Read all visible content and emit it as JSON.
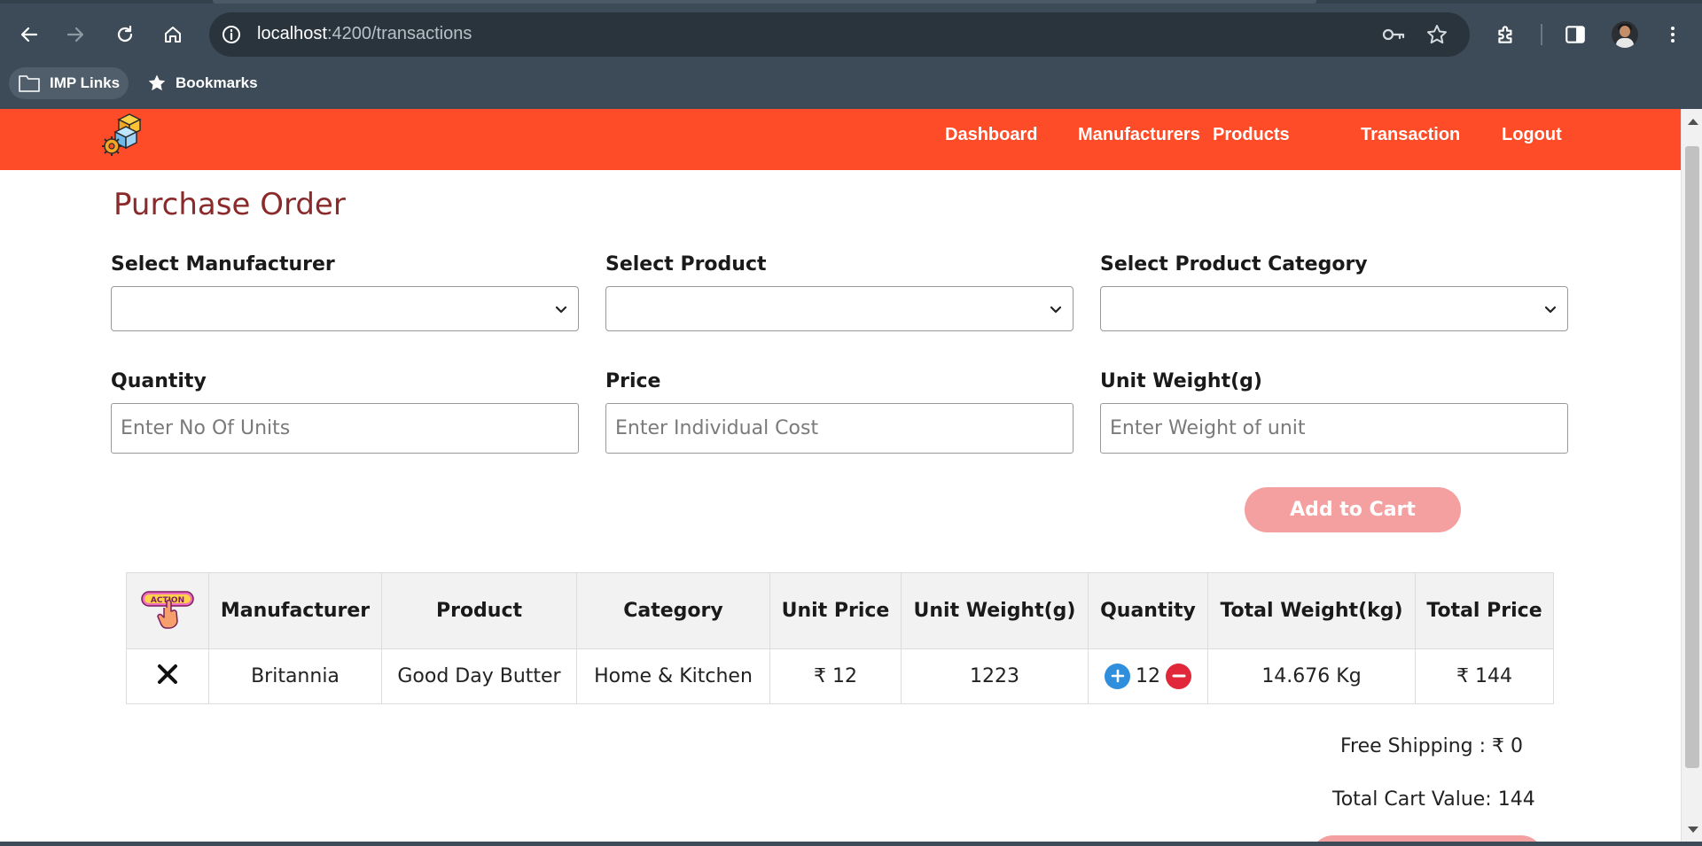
{
  "browser": {
    "url_host": "localhost",
    "url_path": ":4200/transactions",
    "bookmarks": [
      {
        "label": "IMP Links",
        "icon": "folder-icon"
      },
      {
        "label": "Bookmarks",
        "icon": "star-icon"
      }
    ]
  },
  "nav": {
    "logo": "warehouse-logo",
    "links": [
      "Dashboard",
      "Manufacturers",
      "Products",
      "Transaction",
      "Logout"
    ]
  },
  "page": {
    "title": "Purchase Order"
  },
  "form": {
    "manufacturer_label": "Select Manufacturer",
    "manufacturer_value": "",
    "product_label": "Select Product",
    "product_value": "",
    "category_label": "Select Product Category",
    "category_value": "",
    "quantity_label": "Quantity",
    "quantity_placeholder": "Enter No Of Units",
    "price_label": "Price",
    "price_placeholder": "Enter Individual Cost",
    "weight_label": "Unit Weight(g)",
    "weight_placeholder": "Enter Weight of unit",
    "add_button": "Add to Cart"
  },
  "table": {
    "action_icon_text": "ACTION",
    "headers": [
      "Manufacturer",
      "Product",
      "Category",
      "Unit Price",
      "Unit Weight(g)",
      "Quantity",
      "Total Weight(kg)",
      "Total Price"
    ],
    "rows": [
      {
        "manufacturer": "Britannia",
        "product": "Good Day Butter",
        "category": "Home & Kitchen",
        "unit_price": "₹ 12",
        "unit_weight": "1223",
        "quantity": "12",
        "total_weight": "14.676 Kg",
        "total_price": "₹ 144"
      }
    ]
  },
  "summary": {
    "shipping": "Free Shipping : ₹ 0",
    "cart_value": "Total Cart Value: 144"
  },
  "colors": {
    "nav_bg": "#ff4c28",
    "title": "#8b2a2a",
    "button_disabled": "#f4a0a0",
    "plus": "#2f8fdc",
    "minus": "#e0283a"
  }
}
